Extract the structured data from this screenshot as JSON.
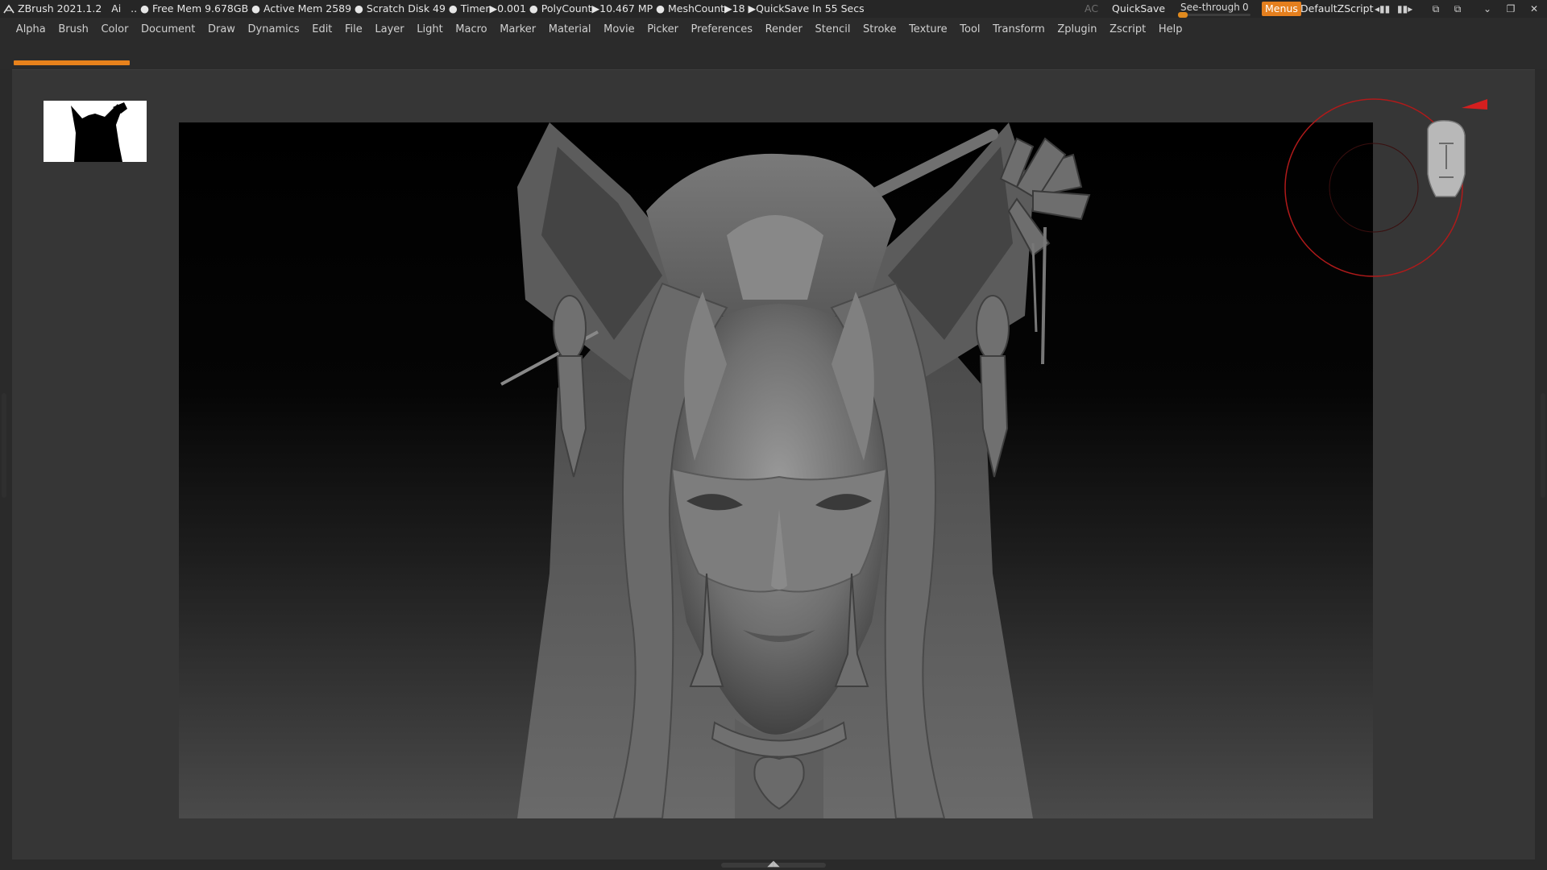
{
  "titlebar": {
    "app": "ZBrush 2021.1.2",
    "ai": "Ai",
    "sep": "..",
    "status": "● Free Mem 9.678GB ● Active Mem 2589 ● Scratch Disk 49 ●  Timer▶0.001 ● PolyCount▶10.467 MP  ● MeshCount▶18  ▶QuickSave In 55 Secs",
    "ac": "AC",
    "quicksave": "QuickSave",
    "see_through_label": "See-through",
    "see_through_value": "0",
    "see_through_level": 0,
    "menus": "Menus",
    "default_zscript": "DefaultZScript"
  },
  "menu": [
    "Alpha",
    "Brush",
    "Color",
    "Document",
    "Draw",
    "Dynamics",
    "Edit",
    "File",
    "Layer",
    "Light",
    "Macro",
    "Marker",
    "Material",
    "Movie",
    "Picker",
    "Preferences",
    "Render",
    "Stencil",
    "Stroke",
    "Texture",
    "Tool",
    "Transform",
    "Zplugin",
    "Zscript",
    "Help"
  ],
  "progress_fraction": 0.08,
  "colors": {
    "accent": "#e47f1e",
    "panel": "#2b2b2b",
    "document": "#363636",
    "gyro_red": "#d41f1f",
    "axis_green": "#19d93a",
    "axis_blue": "#1f35ff"
  },
  "icons": [
    "zbrush-logo-icon",
    "close-icon",
    "maximize-icon",
    "minimize-icon",
    "layout-icon",
    "layout-alt-icon",
    "scroll-right-icon",
    "scroll-left-icon",
    "navigation-head-icon",
    "axis-gizmo-icon",
    "rotation-ring-icon"
  ]
}
